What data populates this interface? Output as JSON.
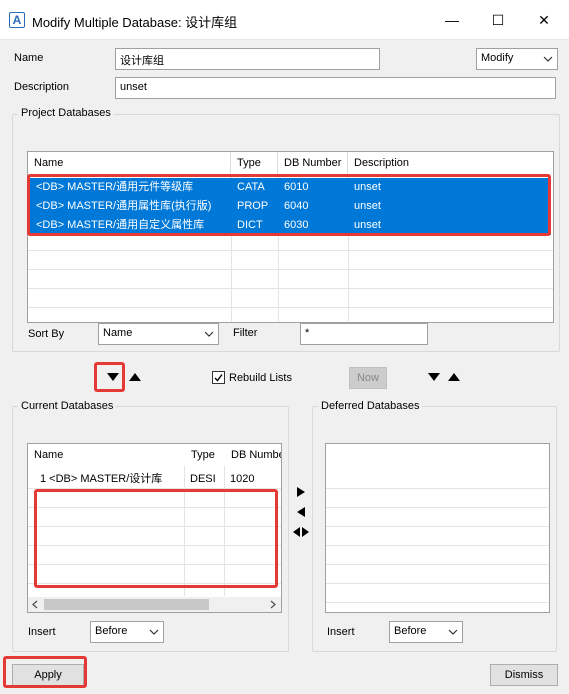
{
  "window": {
    "title": "Modify Multiple Database: 设计库组",
    "minimize_glyph": "—",
    "maximize_glyph": "☐",
    "close_glyph": "✕",
    "app_icon": "A"
  },
  "form": {
    "name_label": "Name",
    "name_value": "设计库组",
    "mode_value": "Modify",
    "description_label": "Description",
    "description_value": "unset"
  },
  "project_databases": {
    "group_label": "Project Databases",
    "columns": [
      "Name",
      "Type",
      "DB Number",
      "Description"
    ],
    "rows": [
      {
        "name": "<DB>    MASTER/通用元件等级库",
        "type": "CATA",
        "number": "6010",
        "description": "unset",
        "selected": true
      },
      {
        "name": "<DB>    MASTER/通用属性库(执行版)",
        "type": "PROP",
        "number": "6040",
        "description": "unset",
        "selected": true
      },
      {
        "name": "<DB>    MASTER/通用自定义属性库",
        "type": "DICT",
        "number": "6030",
        "description": "unset",
        "selected": true
      }
    ],
    "sort_by_label": "Sort By",
    "sort_by_value": "Name",
    "filter_label": "Filter",
    "filter_value": "*"
  },
  "controls": {
    "rebuild_lists_label": "Rebuild Lists",
    "rebuild_checked": true,
    "now_label": "Now"
  },
  "current_databases": {
    "group_label": "Current Databases",
    "columns": [
      "Name",
      "Type",
      "DB Numbe"
    ],
    "rows": [
      {
        "name": "1 <DB>    MASTER/设计库",
        "type": "DESI",
        "number": "1020"
      }
    ],
    "insert_label": "Insert",
    "insert_value": "Before"
  },
  "deferred_databases": {
    "group_label": "Deferred Databases",
    "insert_label": "Insert",
    "insert_value": "Before"
  },
  "footer": {
    "apply_label": "Apply",
    "dismiss_label": "Dismiss"
  },
  "colors": {
    "selection": "#0078d7",
    "highlight_border": "#e53935",
    "window_bg": "#f0f0f0"
  }
}
